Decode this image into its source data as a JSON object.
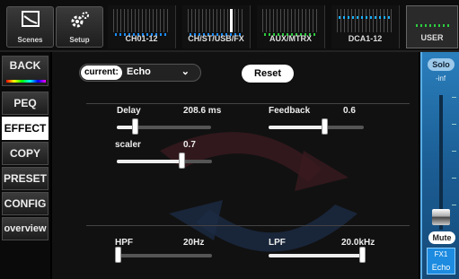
{
  "toolbar": {
    "scenes_label": "Scenes",
    "setup_label": "Setup"
  },
  "channel_tabs": [
    {
      "label": "CH01-12"
    },
    {
      "label": "CH/ST/USB/FX"
    },
    {
      "label": "AUX/MTRX"
    },
    {
      "label": "DCA1-12"
    },
    {
      "label": "USER"
    }
  ],
  "sidebar": {
    "items": [
      {
        "label": "BACK"
      },
      {
        "label": "PEQ"
      },
      {
        "label": "EFFECT"
      },
      {
        "label": "COPY"
      },
      {
        "label": "PRESET"
      },
      {
        "label": "CONFIG"
      },
      {
        "label": "overview"
      }
    ]
  },
  "effect": {
    "current_label": "current:",
    "current_value": "Echo",
    "reset_label": "Reset",
    "params": {
      "delay": {
        "label": "Delay",
        "value": "208.6 ms",
        "level": 0.17
      },
      "feedback": {
        "label": "Feedback",
        "value": "0.6",
        "level": 0.6
      },
      "scaler": {
        "label": "scaler",
        "value": "0.7",
        "level": 0.7
      },
      "hpf": {
        "label": "HPF",
        "value": "20Hz",
        "level": 0.0
      },
      "lpf": {
        "label": "LPF",
        "value": "20.0kHz",
        "level": 1.0
      }
    }
  },
  "strip": {
    "solo_label": "Solo",
    "level": "-inf",
    "mute_label": "Mute",
    "channel_id": "FX1",
    "channel_name": "Echo"
  },
  "colors": {
    "strip_blue": "#1b5d94",
    "meter_blue": "#1a8cff",
    "meter_green": "#2ecc40"
  }
}
